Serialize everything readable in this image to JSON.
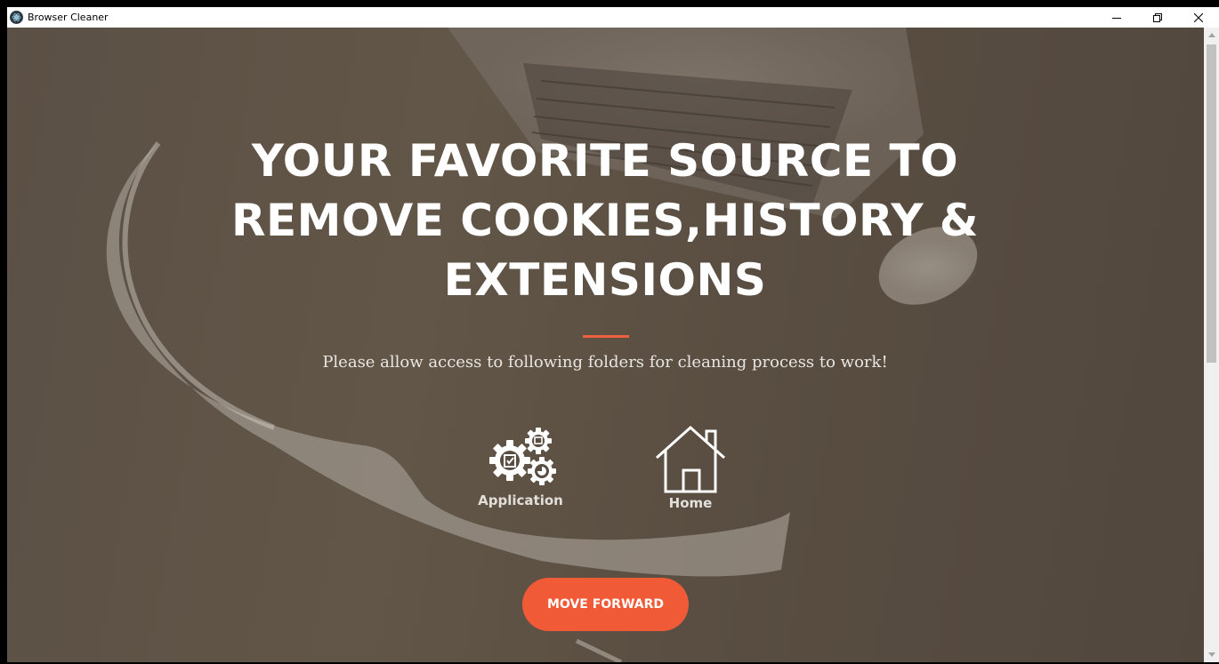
{
  "window": {
    "title": "Browser Cleaner",
    "controls": {
      "minimize": "minimize-icon",
      "maximize": "restore-icon",
      "close": "close-icon"
    }
  },
  "hero": {
    "title": "YOUR FAVORITE SOURCE TO REMOVE COOKIES,HISTORY & EXTENSIONS",
    "subtitle": "Please allow access to following folders for cleaning process to work!"
  },
  "folders": [
    {
      "label": "Application",
      "icon": "gears-icon"
    },
    {
      "label": "Home",
      "icon": "home-icon"
    }
  ],
  "actions": {
    "move_forward": "MOVE FORWARD"
  },
  "colors": {
    "accent": "#f05a36",
    "overlay": "#5b5045",
    "text": "#ffffff"
  }
}
